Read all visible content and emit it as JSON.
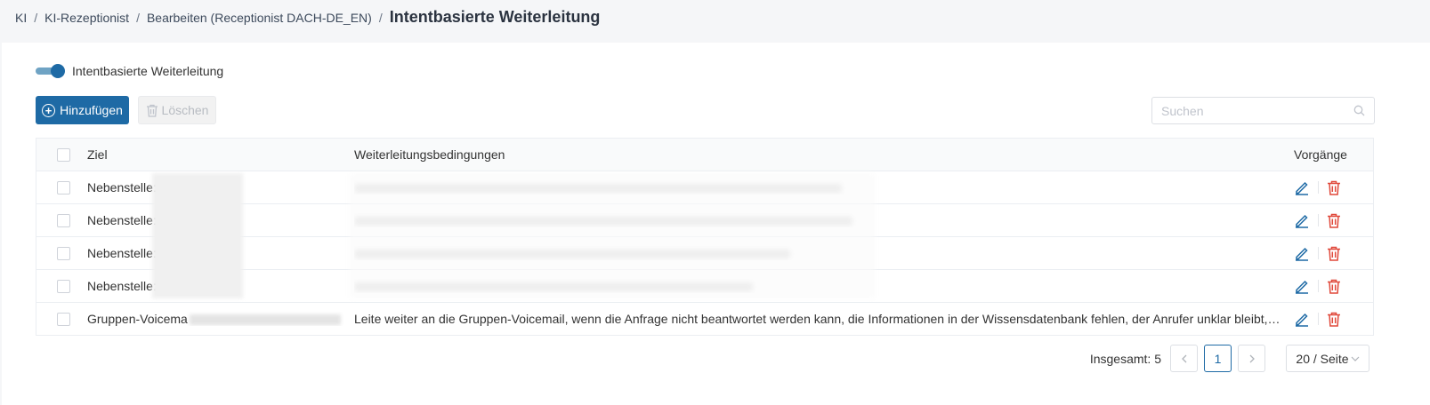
{
  "breadcrumb": {
    "items": [
      "KI",
      "KI-Rezeptionist",
      "Bearbeiten (Receptionist DACH-DE_EN)"
    ],
    "separator": "/",
    "current": "Intentbasierte Weiterleitung"
  },
  "toggle": {
    "label": "Intentbasierte Weiterleitung",
    "on": true
  },
  "toolbar": {
    "add_label": "Hinzufügen",
    "delete_label": "Löschen"
  },
  "search": {
    "placeholder": "Suchen",
    "value": ""
  },
  "table": {
    "headers": {
      "target": "Ziel",
      "conditions": "Weiterleitungsbedingungen",
      "actions": "Vorgänge"
    },
    "rows": [
      {
        "target": "Nebenstelle:",
        "condition": ""
      },
      {
        "target": "Nebenstelle:",
        "condition": ""
      },
      {
        "target": "Nebenstelle:",
        "condition": ""
      },
      {
        "target": "Nebenstelle:",
        "condition": ""
      },
      {
        "target": "Gruppen-Voicema",
        "condition": "Leite weiter an die Gruppen-Voicemail, wenn die Anfrage nicht beantwortet werden kann, die Informationen in der Wissensdatenbank fehlen, der Anrufer unklar bleibt, der Anrufer ausdrücklich eine Nachricht hinterlassen möchte"
      }
    ]
  },
  "pagination": {
    "total_label": "Insgesamt: 5",
    "current_page": "1",
    "page_size": "20 / Seite"
  },
  "colors": {
    "primary": "#1e6aa5",
    "danger": "#e0483a",
    "toggle_track": "#6fa3c4"
  },
  "icons": {
    "edit": "pencil-icon",
    "delete": "trash-icon",
    "search": "search-icon",
    "add": "plus-circle-icon"
  }
}
